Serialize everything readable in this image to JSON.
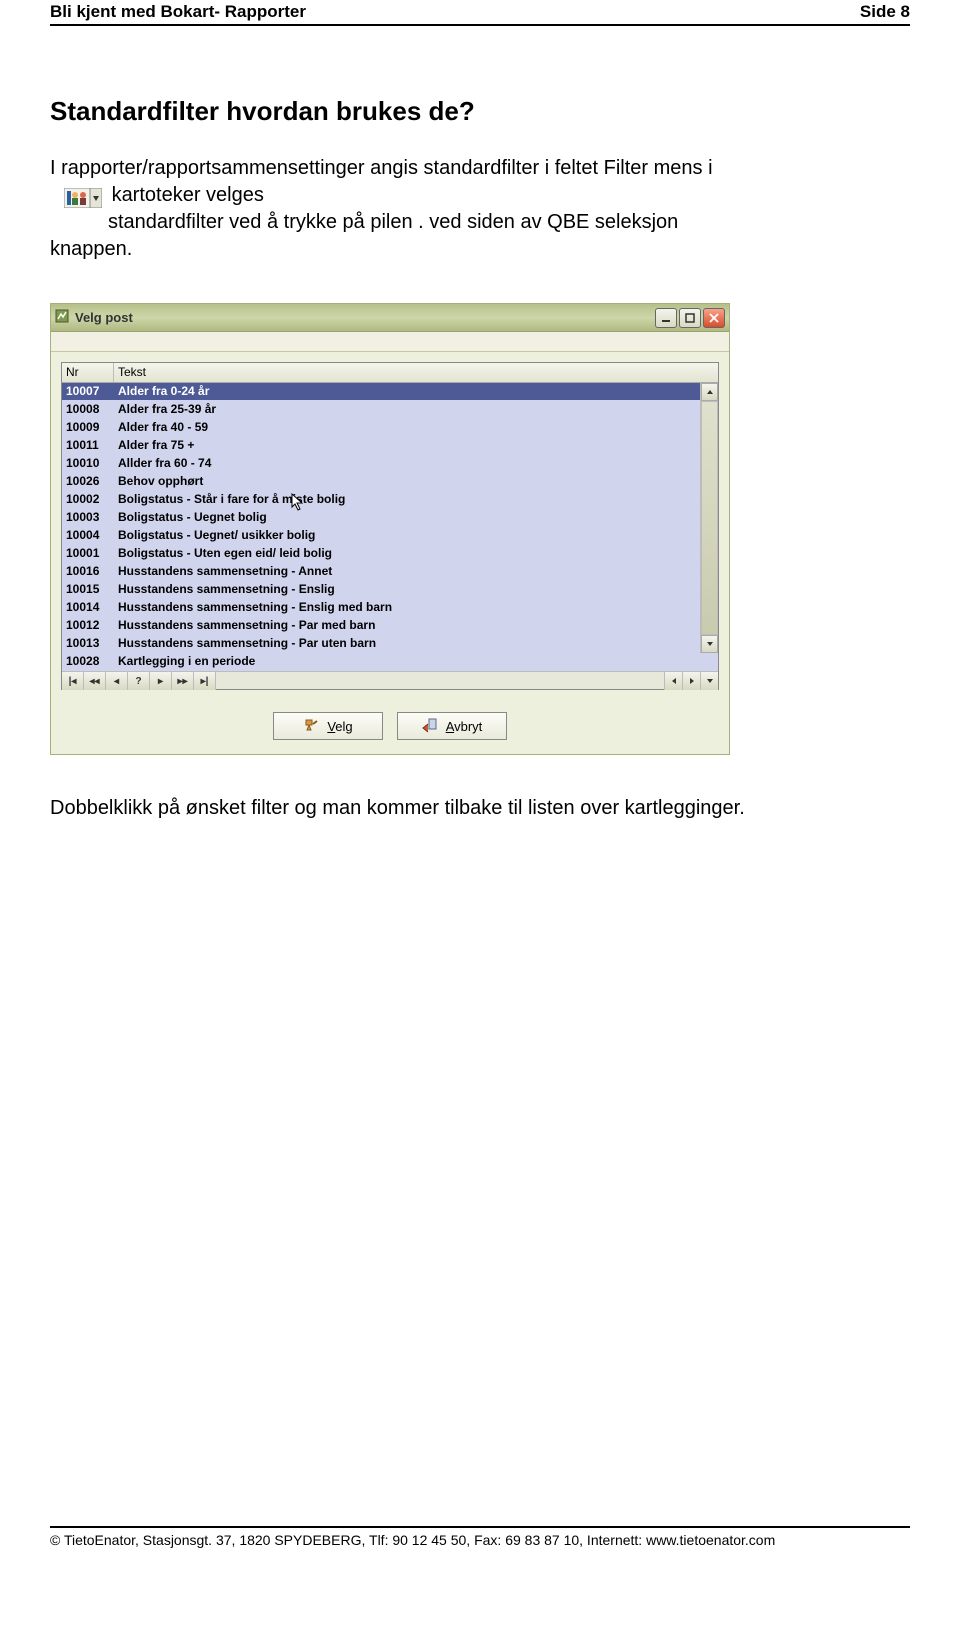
{
  "header": {
    "left": "Bli kjent med Bokart- Rapporter",
    "right": "Side 8"
  },
  "section": {
    "title": "Standardfilter hvordan brukes de?",
    "para1_a": "I rapporter/rapportsammensettinger angis standardfilter i feltet Filter mens i",
    "para1_b": "kartoteker velges",
    "para1_c": "standardfilter ved å trykke på pilen . ved siden av QBE seleksjon",
    "para1_d": "knappen."
  },
  "window": {
    "title": "Velg post",
    "columns": {
      "nr": "Nr",
      "tekst": "Tekst"
    },
    "rows": [
      {
        "nr": "10007",
        "tekst": "Alder fra 0-24 år",
        "selected": true
      },
      {
        "nr": "10008",
        "tekst": "Alder fra 25-39 år"
      },
      {
        "nr": "10009",
        "tekst": "Alder fra 40 - 59"
      },
      {
        "nr": "10011",
        "tekst": "Alder fra 75 +"
      },
      {
        "nr": "10010",
        "tekst": "Allder fra 60 - 74"
      },
      {
        "nr": "10026",
        "tekst": "Behov opphørt"
      },
      {
        "nr": "10002",
        "tekst": "Boligstatus - Står i fare for å miste bolig"
      },
      {
        "nr": "10003",
        "tekst": "Boligstatus - Uegnet bolig"
      },
      {
        "nr": "10004",
        "tekst": "Boligstatus - Uegnet/ usikker bolig"
      },
      {
        "nr": "10001",
        "tekst": "Boligstatus - Uten egen eid/ leid bolig"
      },
      {
        "nr": "10016",
        "tekst": "Husstandens sammensetning - Annet"
      },
      {
        "nr": "10015",
        "tekst": "Husstandens sammensetning - Enslig"
      },
      {
        "nr": "10014",
        "tekst": "Husstandens sammensetning - Enslig med barn"
      },
      {
        "nr": "10012",
        "tekst": "Husstandens sammensetning - Par med barn"
      },
      {
        "nr": "10013",
        "tekst": "Husstandens sammensetning - Par uten barn"
      },
      {
        "nr": "10028",
        "tekst": "Kartlegging i en periode"
      }
    ],
    "nav": [
      "|◂",
      "◂◂",
      "◂",
      "?",
      "▸",
      "▸▸",
      "▸|"
    ],
    "buttons": {
      "velg": "Velg",
      "avbryt": "Avbryt"
    }
  },
  "after_text": "Dobbelklikk på ønsket filter og man kommer tilbake til listen over kartlegginger.",
  "footer": "© TietoEnator, Stasjonsgt. 37, 1820 SPYDEBERG, Tlf: 90 12 45 50, Fax: 69 83 87 10, Internett: www.tietoenator.com"
}
